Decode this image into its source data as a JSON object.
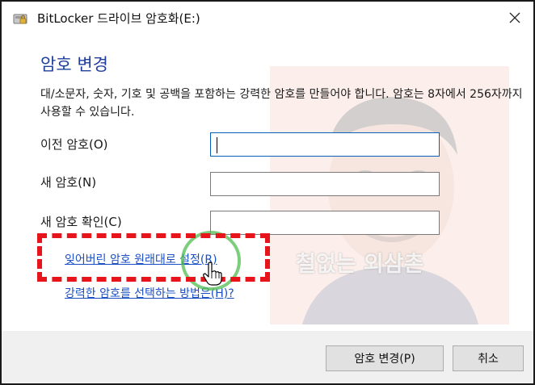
{
  "window": {
    "title": "BitLocker 드라이브 암호화(E:)",
    "icon": "bitlocker-drive-icon",
    "close_glyph": "✕"
  },
  "dialog": {
    "heading": "암호 변경",
    "description": "대/소문자, 숫자, 기호 및 공백을 포함하는 강력한 암호를 만들어야 합니다. 암호는 8자에서 256자까지 사용할 수 있습니다."
  },
  "fields": [
    {
      "label": "이전 암호(O)",
      "value": ""
    },
    {
      "label": "새 암호(N)",
      "value": ""
    },
    {
      "label": "새 암호 확인(C)",
      "value": ""
    }
  ],
  "links": {
    "reset": "잊어버린 암호 원래대로 설정(R)",
    "help": "강력한 암호를 선택하는 방법은(H)?"
  },
  "overlay": {
    "watermark": "철없는 외삼촌",
    "highlight_color": "#e8141c",
    "circle_color": "#50be50"
  },
  "buttons": {
    "change": "암호 변경(P)",
    "cancel": "취소"
  },
  "colors": {
    "heading": "#1e3f9c",
    "link": "#1a4fc4",
    "footer_bg": "#f0f0f0"
  }
}
